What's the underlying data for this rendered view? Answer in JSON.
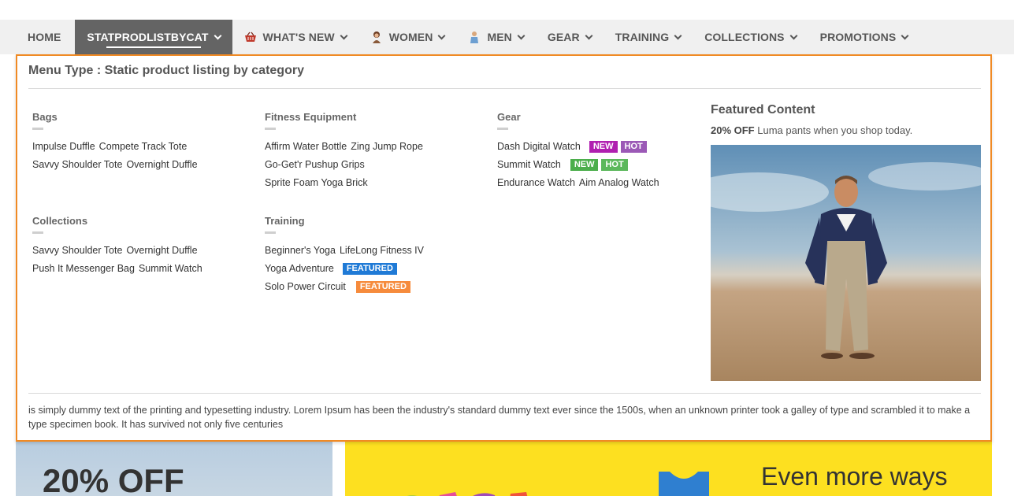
{
  "nav": {
    "items": [
      {
        "label": "HOME",
        "icon": ""
      },
      {
        "label": "STATPRODLISTBYCAT",
        "icon": ""
      },
      {
        "label": "WHAT'S NEW",
        "icon": "basket-icon"
      },
      {
        "label": "WOMEN",
        "icon": "woman-icon"
      },
      {
        "label": "MEN",
        "icon": "man-icon"
      },
      {
        "label": "GEAR",
        "icon": ""
      },
      {
        "label": "TRAINING",
        "icon": ""
      },
      {
        "label": "COLLECTIONS",
        "icon": ""
      },
      {
        "label": "PROMOTIONS",
        "icon": ""
      }
    ],
    "active_index": 1
  },
  "mega_menu": {
    "menu_type": "Menu Type : Static product listing by category",
    "categories": {
      "bags": {
        "title": "Bags",
        "rows": [
          [
            "Impulse Duffle",
            "Compete Track Tote"
          ],
          [
            "Savvy Shoulder Tote",
            "Overnight Duffle"
          ]
        ]
      },
      "fitness": {
        "title": "Fitness Equipment",
        "rows": [
          [
            "Affirm Water Bottle",
            "Zing Jump Rope"
          ],
          [
            "Go-Get'r Pushup Grips"
          ],
          [
            "Sprite Foam Yoga Brick"
          ]
        ]
      },
      "gear": {
        "title": "Gear",
        "rows": [
          [
            "Dash Digital Watch"
          ],
          [
            "Summit Watch"
          ],
          [
            "Endurance Watch",
            "Aim Analog Watch"
          ]
        ],
        "badges_row1": [
          "NEW",
          "HOT"
        ],
        "badges_row2": [
          "NEW",
          "HOT"
        ]
      },
      "collections": {
        "title": "Collections",
        "rows": [
          [
            "Savvy Shoulder Tote",
            "Overnight Duffle"
          ],
          [
            "Push It Messenger Bag",
            "Summit Watch"
          ]
        ]
      },
      "training": {
        "title": "Training",
        "rows": [
          [
            "Beginner's Yoga",
            "LifeLong Fitness IV"
          ],
          [
            "Yoga Adventure"
          ],
          [
            "Solo Power Circuit"
          ]
        ],
        "badge_row2": "FEATURED",
        "badge_row3": "FEATURED"
      }
    },
    "featured": {
      "title": "Featured Content",
      "highlight": "20% OFF",
      "text": " Luma pants when you shop today."
    },
    "footer_text": "is simply dummy text of the printing and typesetting industry. Lorem Ipsum has been the industry's standard dummy text ever since the 1500s, when an unknown printer took a galley of type and scrambled it to make a type specimen book. It has survived not only five centuries"
  },
  "banners": {
    "left_text": "20% OFF",
    "right_text": "Even more ways"
  },
  "colors": {
    "accent_border": "#f08a24",
    "badge_new_purple": "#b020b0",
    "badge_hot_purple": "#9b59b6",
    "badge_new_green": "#4cae4c",
    "badge_hot_green": "#5cb85c",
    "badge_featured_blue": "#1f7ad6",
    "badge_featured_orange": "#f68b3c"
  }
}
